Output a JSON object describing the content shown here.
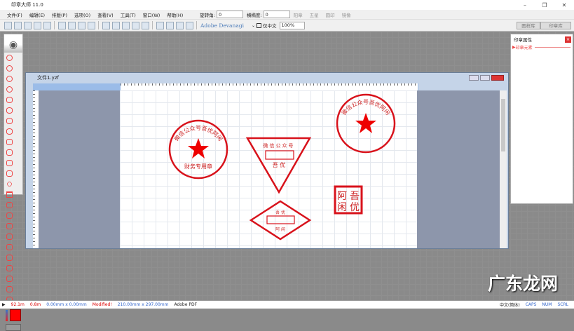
{
  "app": {
    "title": "印章大师 11.0"
  },
  "window_controls": {
    "minimize": "–",
    "maximize": "❐",
    "close": "✕"
  },
  "menu": [
    "文件(F)",
    "编辑(E)",
    "排版(P)",
    "选项(O)",
    "查看(V)",
    "工具(T)",
    "窗口(W)",
    "帮助(H)"
  ],
  "props": {
    "rotate_label": "旋转角:",
    "rotate_value": "0",
    "ellipse_label": "横椭度:",
    "ellipse_value": "0",
    "checks": [
      "阳章",
      "五星",
      "圆印",
      "镜像"
    ]
  },
  "toolbar": {
    "font": "Adobe Devanagi",
    "only_chinese": "仅中文",
    "zoom": "100%"
  },
  "right_tabs": [
    "图样库",
    "印章库"
  ],
  "right_panel": {
    "title": "印章属性",
    "section": "印章元素",
    "close": "×"
  },
  "document": {
    "title": "文件1.yzf"
  },
  "stamps": {
    "round1": {
      "arc": "微信公众号吾优阿闲",
      "bottom": "财务专用章"
    },
    "round2": {
      "arc": "微信公众号吾优阿闲"
    },
    "triangle": {
      "top": "微信公众号",
      "bottom": "吾 优"
    },
    "diamond": {
      "top": "吾 优",
      "bottom": "阿 闲"
    },
    "square": {
      "chars": [
        "吾",
        "阿",
        "优",
        "闲"
      ]
    }
  },
  "status": {
    "a": "92.1m",
    "b": "0.8m",
    "pos": "0.00mm x 0.00mm",
    "modified": "Modified!",
    "size": "210.00mm x 297.00mm",
    "printer": "Adobe PDF",
    "ime": "中文(简体)",
    "caps": "CAPS",
    "num": "NUM",
    "scrl": "SCRL"
  },
  "watermark": "广东龙网",
  "colors": {
    "stamp": "#d8121b"
  }
}
